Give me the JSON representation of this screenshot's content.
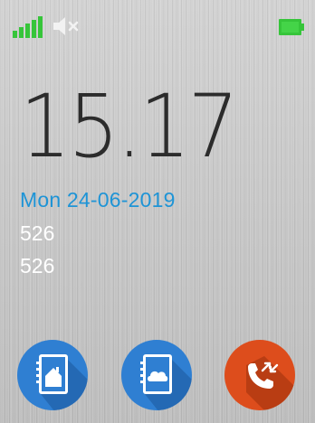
{
  "status_bar": {
    "signal_icon": "signal-strength-icon",
    "volume_icon": "volume-muted-icon",
    "battery_icon": "battery-full-icon",
    "signal_color": "#36c53a",
    "battery_color": "#36c53a"
  },
  "clock": {
    "time": "15.17",
    "date": "Mon 24-06-2019",
    "line1": "526",
    "line2": "526"
  },
  "colors": {
    "date": "#1e94d6",
    "app_blue": "#2f7fd2",
    "app_orange": "#dd4d1c"
  },
  "apps": [
    {
      "icon": "home-contacts-icon"
    },
    {
      "icon": "cloud-contacts-icon"
    },
    {
      "icon": "call-log-icon"
    }
  ]
}
